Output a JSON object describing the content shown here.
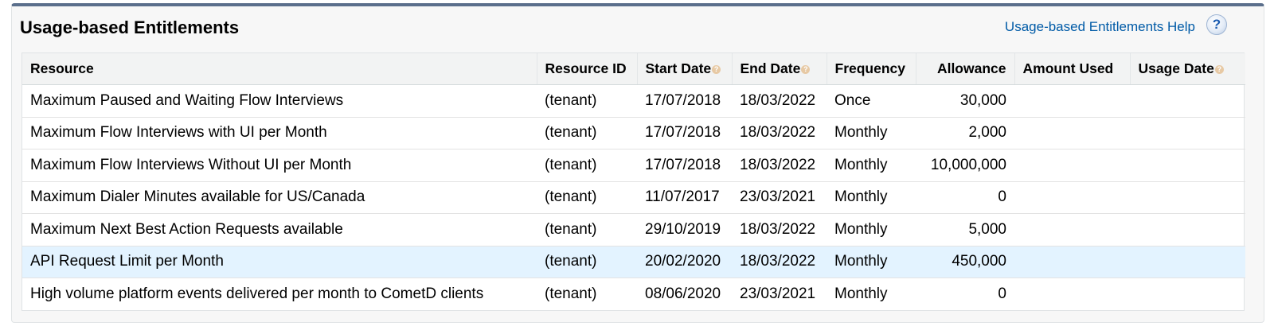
{
  "panel": {
    "title": "Usage-based Entitlements",
    "help_link": "Usage-based Entitlements Help",
    "help_icon": "question-mark-icon"
  },
  "table": {
    "columns": [
      {
        "key": "resource",
        "label": "Resource",
        "hint": false
      },
      {
        "key": "resource_id",
        "label": "Resource ID",
        "hint": false
      },
      {
        "key": "start_date",
        "label": "Start Date",
        "hint": true
      },
      {
        "key": "end_date",
        "label": "End Date",
        "hint": true
      },
      {
        "key": "frequency",
        "label": "Frequency",
        "hint": false
      },
      {
        "key": "allowance",
        "label": "Allowance",
        "hint": false
      },
      {
        "key": "amount_used",
        "label": "Amount Used",
        "hint": false
      },
      {
        "key": "usage_date",
        "label": "Usage Date",
        "hint": true
      }
    ],
    "rows": [
      {
        "resource": "Maximum Paused and Waiting Flow Interviews",
        "resource_id": "(tenant)",
        "start_date": "17/07/2018",
        "end_date": "18/03/2022",
        "frequency": "Once",
        "allowance": "30,000",
        "amount_used": "",
        "usage_date": "",
        "highlight": false
      },
      {
        "resource": "Maximum Flow Interviews with UI per Month",
        "resource_id": "(tenant)",
        "start_date": "17/07/2018",
        "end_date": "18/03/2022",
        "frequency": "Monthly",
        "allowance": "2,000",
        "amount_used": "",
        "usage_date": "",
        "highlight": false
      },
      {
        "resource": "Maximum Flow Interviews Without UI per Month",
        "resource_id": "(tenant)",
        "start_date": "17/07/2018",
        "end_date": "18/03/2022",
        "frequency": "Monthly",
        "allowance": "10,000,000",
        "amount_used": "",
        "usage_date": "",
        "highlight": false
      },
      {
        "resource": "Maximum Dialer Minutes available for US/Canada",
        "resource_id": "(tenant)",
        "start_date": "11/07/2017",
        "end_date": "23/03/2021",
        "frequency": "Monthly",
        "allowance": "0",
        "amount_used": "",
        "usage_date": "",
        "highlight": false
      },
      {
        "resource": "Maximum Next Best Action Requests available",
        "resource_id": "(tenant)",
        "start_date": "29/10/2019",
        "end_date": "18/03/2022",
        "frequency": "Monthly",
        "allowance": "5,000",
        "amount_used": "",
        "usage_date": "",
        "highlight": false
      },
      {
        "resource": "API Request Limit per Month",
        "resource_id": "(tenant)",
        "start_date": "20/02/2020",
        "end_date": "18/03/2022",
        "frequency": "Monthly",
        "allowance": "450,000",
        "amount_used": "",
        "usage_date": "",
        "highlight": true
      },
      {
        "resource": "High volume platform events delivered per month to CometD clients",
        "resource_id": "(tenant)",
        "start_date": "08/06/2020",
        "end_date": "23/03/2021",
        "frequency": "Monthly",
        "allowance": "0",
        "amount_used": "",
        "usage_date": "",
        "highlight": false
      }
    ]
  },
  "colors": {
    "header_bar": "#5b6f8c",
    "link": "#015ba7",
    "highlight_row": "#e3f3ff",
    "hint_icon": "#e7c9a4"
  }
}
